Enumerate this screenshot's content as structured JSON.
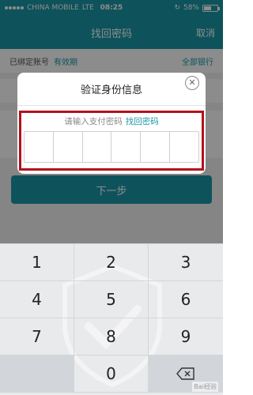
{
  "status_bar": {
    "carrier": "CHINA MOBILE",
    "network": "LTE",
    "time": "08:25",
    "battery": "58%",
    "battery_level": 0.58
  },
  "header": {
    "title": "找回密码",
    "right_action": "取消"
  },
  "page": {
    "row1_label": "已绑定账号",
    "row1_accent": "有效期",
    "row1_link": "全部银行",
    "next_button": "下一步"
  },
  "dialog": {
    "title": "验证身份信息",
    "prompt": "请输入支付密码",
    "link": "找回密码",
    "pin_length": 6
  },
  "keypad": {
    "keys": [
      "1",
      "2",
      "3",
      "4",
      "5",
      "6",
      "7",
      "8",
      "9",
      "",
      "0",
      ""
    ]
  },
  "watermark": "Bai经验"
}
